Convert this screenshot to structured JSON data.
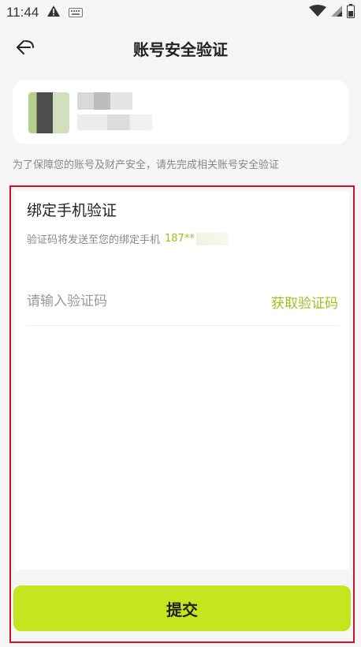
{
  "status_bar": {
    "time": "11:44",
    "icons": [
      "warning-icon",
      "keyboard-icon",
      "wifi-icon",
      "signal-icon",
      "battery-icon"
    ]
  },
  "header": {
    "back_icon": "back-arrow-icon",
    "title": "账号安全验证"
  },
  "account": {
    "avatar": "pixelated-avatar"
  },
  "notice": "为了保障您的账号及财产安全，请先完成相关账号安全验证",
  "verify": {
    "title": "绑定手机验证",
    "desc_prefix": "验证码将发送至您的绑定手机",
    "phone": "187**",
    "input_placeholder": "请输入验证码",
    "input_value": "",
    "get_code_label": "获取验证码"
  },
  "submit_label": "提交",
  "colors": {
    "accent": "#9bc21b",
    "button": "#c5e61e",
    "highlight_border": "#d0102a"
  }
}
